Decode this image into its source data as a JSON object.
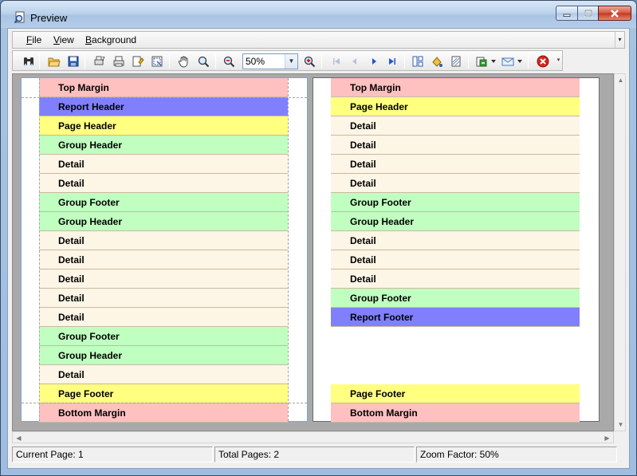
{
  "window": {
    "title": "Preview",
    "icon": "preview-app-icon"
  },
  "menu": {
    "items": [
      {
        "label": "File",
        "accel": "F",
        "rest": "ile"
      },
      {
        "label": "View",
        "accel": "V",
        "rest": "iew"
      },
      {
        "label": "Background",
        "accel": "B",
        "rest": "ackground"
      }
    ]
  },
  "toolbar": {
    "zoom_value": "50%",
    "icons": [
      "find-icon",
      "open-icon",
      "save-icon",
      "print-setup-icon",
      "print-icon",
      "quick-print-icon",
      "page-setup-icon",
      "hand-tool-icon",
      "magnifier-icon",
      "zoom-out-icon",
      "zoom-in-icon",
      "first-page-icon",
      "previous-page-icon",
      "next-page-icon",
      "last-page-icon",
      "multiple-pages-icon",
      "color-icon",
      "watermark-icon",
      "export-icon",
      "send-email-icon",
      "close-preview-icon"
    ]
  },
  "colors": {
    "margin": "#ffc0c0",
    "report": "#8080ff",
    "page": "#ffff80",
    "group": "#c0ffc0",
    "detail": "#fdf5e6"
  },
  "pages": [
    {
      "bands": [
        {
          "label": "Top Margin",
          "kind": "margin"
        },
        {
          "label": "Report Header",
          "kind": "report"
        },
        {
          "label": "Page Header",
          "kind": "page"
        },
        {
          "label": "Group Header",
          "kind": "group"
        },
        {
          "label": "Detail",
          "kind": "detail"
        },
        {
          "label": "Detail",
          "kind": "detail"
        },
        {
          "label": "Group Footer",
          "kind": "group"
        },
        {
          "label": "Group Header",
          "kind": "group"
        },
        {
          "label": "Detail",
          "kind": "detail"
        },
        {
          "label": "Detail",
          "kind": "detail"
        },
        {
          "label": "Detail",
          "kind": "detail"
        },
        {
          "label": "Detail",
          "kind": "detail"
        },
        {
          "label": "Detail",
          "kind": "detail"
        },
        {
          "label": "Group Footer",
          "kind": "group"
        },
        {
          "label": "Group Header",
          "kind": "group"
        },
        {
          "label": "Detail",
          "kind": "detail"
        },
        {
          "label": "Page Footer",
          "kind": "page"
        },
        {
          "label": "Bottom Margin",
          "kind": "margin"
        }
      ]
    },
    {
      "bands": [
        {
          "label": "Top Margin",
          "kind": "margin"
        },
        {
          "label": "Page Header",
          "kind": "page"
        },
        {
          "label": "Detail",
          "kind": "detail"
        },
        {
          "label": "Detail",
          "kind": "detail"
        },
        {
          "label": "Detail",
          "kind": "detail"
        },
        {
          "label": "Detail",
          "kind": "detail"
        },
        {
          "label": "Group Footer",
          "kind": "group"
        },
        {
          "label": "Group Header",
          "kind": "group"
        },
        {
          "label": "Detail",
          "kind": "detail"
        },
        {
          "label": "Detail",
          "kind": "detail"
        },
        {
          "label": "Detail",
          "kind": "detail"
        },
        {
          "label": "Group Footer",
          "kind": "group"
        },
        {
          "label": "Report Footer",
          "kind": "report"
        }
      ],
      "footer_bands": [
        {
          "label": "Page Footer",
          "kind": "page"
        },
        {
          "label": "Bottom Margin",
          "kind": "margin"
        }
      ]
    }
  ],
  "status": {
    "current_page": "Current Page: 1",
    "total_pages": "Total Pages: 2",
    "zoom_factor": "Zoom Factor: 50%"
  }
}
